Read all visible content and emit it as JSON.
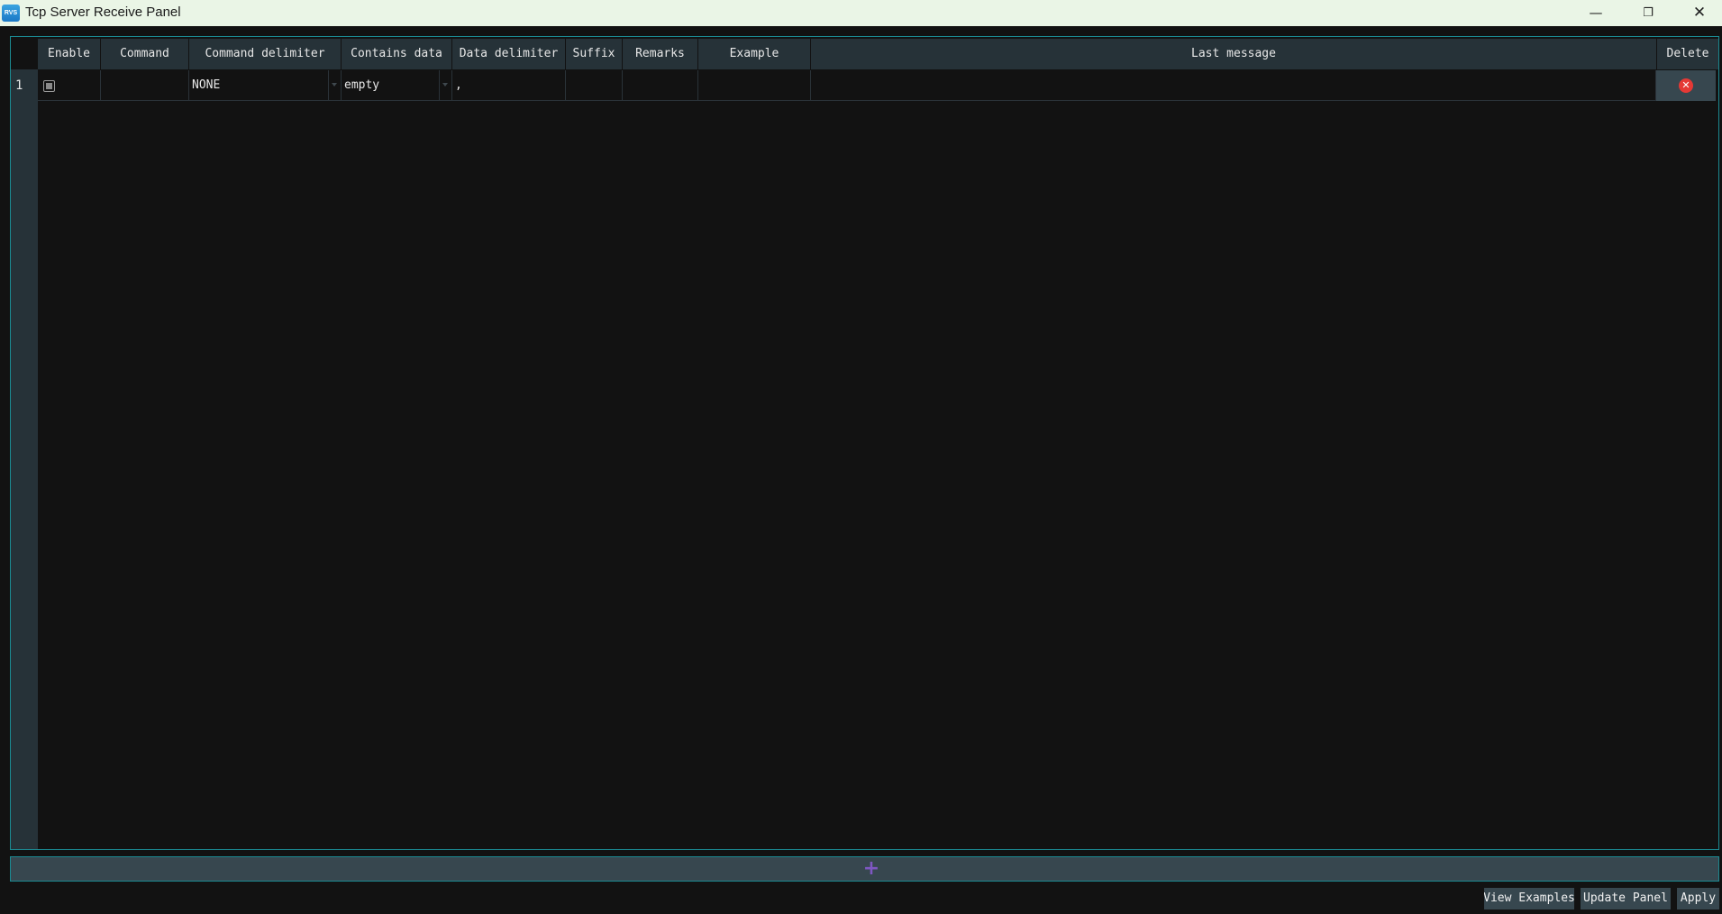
{
  "window": {
    "app_icon_text": "RVS",
    "title": "Tcp Server Receive Panel",
    "minimize": "—",
    "maximize": "❐",
    "close": "✕"
  },
  "table": {
    "columns": [
      "Enable",
      "Command",
      "Command delimiter",
      "Contains data",
      "Data delimiter",
      "Suffix",
      "Remarks",
      "Example",
      "Last message",
      "Delete"
    ],
    "rows": [
      {
        "row_number": "1",
        "enabled": false,
        "command": "",
        "command_delimiter": "NONE",
        "contains_data": "empty",
        "data_delimiter": ",",
        "suffix": "",
        "remarks": "",
        "example": "",
        "last_message": ""
      }
    ]
  },
  "icons": {
    "delete": "✕",
    "add": "+"
  },
  "colors": {
    "accent_border": "#1b8a92",
    "header_bg": "#263238",
    "button_bg": "#37474f",
    "delete_red": "#e53935",
    "add_purple": "#7e57c2"
  },
  "buttons": {
    "view_examples": "View Examples",
    "update_panel": "Update Panel",
    "apply": "Apply"
  }
}
